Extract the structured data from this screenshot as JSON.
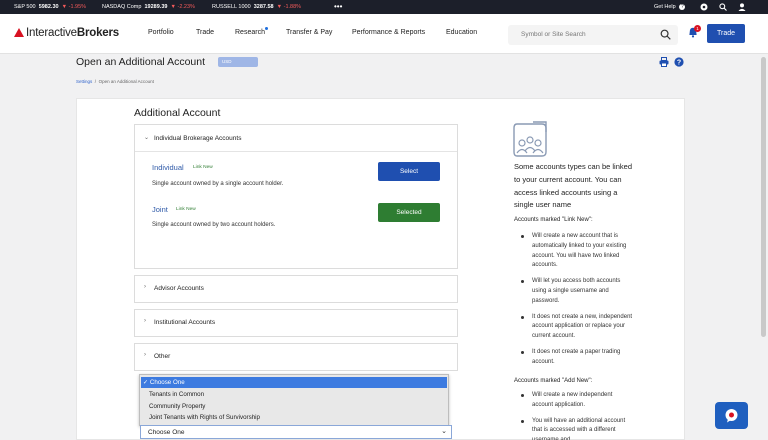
{
  "ticker": [
    {
      "name": "S&P 500",
      "value": "5982.30",
      "change": "▼ -1.95%"
    },
    {
      "name": "NASDAQ Comp",
      "value": "19289.39",
      "change": "▼ -2.23%"
    },
    {
      "name": "RUSSELL 1000",
      "value": "3287.58",
      "change": "▼ -1.88%"
    }
  ],
  "topbar": {
    "help": "Get Help"
  },
  "logo": {
    "brand_light": "Interactive",
    "brand_bold": "Brokers"
  },
  "nav": {
    "items": [
      "Portfolio",
      "Trade",
      "Research",
      "Transfer & Pay",
      "Performance & Reports",
      "Education"
    ]
  },
  "search": {
    "placeholder": "Symbol or Site Search"
  },
  "notifications": {
    "count": "1"
  },
  "trade_button": "Trade",
  "page": {
    "title": "Open an Additional Account",
    "currency": "USD"
  },
  "breadcrumb": {
    "home": "Settings",
    "sep": "/",
    "current": "Open an Additional Account"
  },
  "section_title": "Additional Account",
  "individual_panel": {
    "title": "Individual Brokerage Accounts",
    "accounts": [
      {
        "name": "Individual",
        "tag": "Link New",
        "description": "Single account owned by a single account holder.",
        "button": "Select",
        "button_color": "#1f4fb0"
      },
      {
        "name": "Joint",
        "tag": "Link New",
        "description": "Single account owned by two account holders.",
        "button": "Selected",
        "button_color": "#2e7d32"
      }
    ]
  },
  "collapsed_panels": [
    "Advisor Accounts",
    "Institutional Accounts",
    "Other"
  ],
  "dropdown": {
    "options": [
      "✓ Choose One",
      "Tenants in Common",
      "Community Property",
      "Joint Tenants with Rights of Survivorship"
    ],
    "selected_value": "Choose One"
  },
  "sidebar": {
    "intro": "Some accounts types can be linked to your current account. You can access linked accounts using a single user name",
    "link_heading": "Accounts marked \"Link New\":",
    "link_bullets": [
      "Will create a new account that is automatically linked to your existing account. You will have two linked accounts.",
      "Will let you access both accounts using a single username and password.",
      "It does not create a new, independent account application or replace your current account.",
      "It does not create a paper trading account."
    ],
    "add_heading": "Accounts marked \"Add New\":",
    "add_bullets": [
      "Will create a new independent account application.",
      "You will have an additional account that is accessed with a different username and"
    ]
  },
  "colors": {
    "accent": "#1f4fb0",
    "selected": "#2e7d32",
    "negative": "#f25a5a",
    "link": "#2f5aa8"
  }
}
